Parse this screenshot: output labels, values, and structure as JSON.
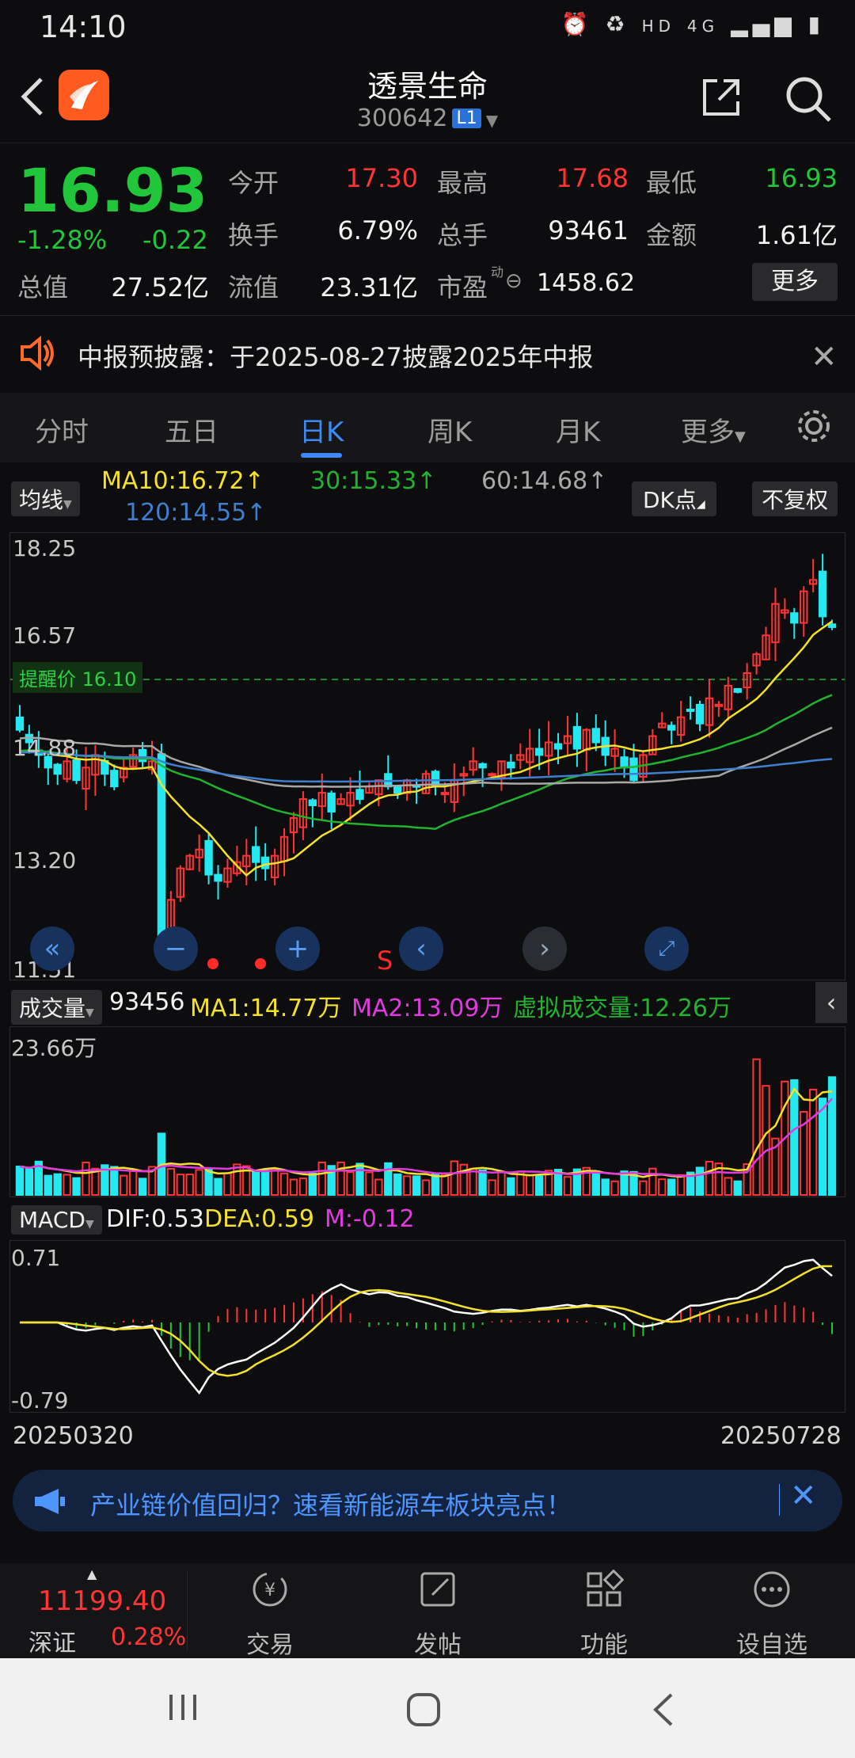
{
  "status_bar": {
    "time": "14:10",
    "hd": "HD",
    "network": "4G"
  },
  "header": {
    "title": "透景生命",
    "code": "300642",
    "level_badge": "L1"
  },
  "quote": {
    "price": "16.93",
    "change_pct": "-1.28%",
    "change": "-0.22",
    "open_label": "今开",
    "open": "17.30",
    "high_label": "最高",
    "high": "17.68",
    "low_label": "最低",
    "low": "16.93",
    "turnover_label": "换手",
    "turnover": "6.79%",
    "volume_label": "总手",
    "volume": "93461",
    "amount_label": "金额",
    "amount": "1.61亿",
    "mktcap_label": "总值",
    "mktcap": "27.52亿",
    "float_label": "流值",
    "float_cap": "23.31亿",
    "pe_label": "市盈",
    "pe_sup": "动",
    "pe": "1458.62",
    "more_label": "更多"
  },
  "notice": {
    "text": "中报预披露：于2025-08-27披露2025年中报"
  },
  "tabs": [
    {
      "label": "分时"
    },
    {
      "label": "五日"
    },
    {
      "label": "日K"
    },
    {
      "label": "周K"
    },
    {
      "label": "月K"
    },
    {
      "label": "更多"
    }
  ],
  "ma_row": {
    "indicator": "均线",
    "ma10": "MA10:16.72↑",
    "ma30": "30:15.33↑",
    "ma60": "60:14.68↑",
    "ma120": "120:14.55↑",
    "dk_label": "DK点",
    "adjust_label": "不复权"
  },
  "price_axis": {
    "top": "18.25",
    "mid1": "16.57",
    "mid2": "14.88",
    "low": "13.20",
    "bottom": "11.51"
  },
  "alert": {
    "label": "提醒价 16.10",
    "value": 16.1
  },
  "chart_controls": {
    "s_marker": "S"
  },
  "volume_row": {
    "indicator": "成交量",
    "volume": "93456",
    "ma1": "MA1:14.77万",
    "ma2": "MA2:13.09万",
    "virtual": "虚拟成交量:12.26万",
    "axis_top": "23.66万"
  },
  "macd_row": {
    "indicator": "MACD",
    "dif": "DIF:0.53",
    "dea": "DEA:0.59",
    "m": "M:-0.12",
    "axis_top": "0.71",
    "axis_bottom": "-0.79"
  },
  "date_range": {
    "start": "20250320",
    "end": "20250728"
  },
  "banner": {
    "text": "产业链价值回归？速看新能源车板块亮点！"
  },
  "bottom_nav": {
    "index_value": "11199.40",
    "index_name": "深证",
    "index_pct": "0.28%",
    "items": [
      {
        "label": "交易"
      },
      {
        "label": "发帖"
      },
      {
        "label": "功能"
      },
      {
        "label": "设自选"
      }
    ]
  },
  "colors": {
    "up": "#ff3535",
    "down": "#21c63a",
    "candle_down": "#25e8f0",
    "accent": "#3d8af7",
    "ma10": "#f5e12a",
    "ma30": "#21b32e",
    "ma60": "#a8a8a8",
    "ma120": "#3f7fd0",
    "macd_m": "#e23ae0"
  },
  "chart_data": {
    "type": "candlestick",
    "x_start": "20250320",
    "x_end": "20250728",
    "ylim": [
      11.51,
      18.25
    ],
    "closes": [
      15.3,
      15.1,
      14.9,
      14.7,
      14.6,
      14.8,
      14.5,
      14.7,
      14.9,
      14.6,
      14.4,
      14.7,
      14.9,
      14.8,
      14.8,
      12.0,
      12.6,
      13.1,
      13.3,
      13.4,
      13.0,
      12.9,
      13.1,
      13.2,
      13.3,
      13.2,
      13.1,
      13.3,
      13.6,
      13.9,
      14.2,
      14.1,
      14.3,
      14.0,
      14.2,
      14.3,
      14.2,
      14.4,
      14.5,
      14.4,
      14.3,
      14.5,
      14.4,
      14.6,
      14.4,
      14.3,
      14.5,
      14.6,
      14.8,
      14.7,
      14.6,
      14.8,
      14.7,
      14.9,
      15.0,
      14.9,
      15.1,
      15.0,
      15.2,
      15.0,
      15.3,
      15.1,
      14.9,
      15.0,
      14.7,
      14.5,
      14.9,
      15.2,
      15.4,
      15.3,
      15.5,
      15.6,
      15.4,
      15.8,
      15.7,
      16.0,
      15.9,
      16.2,
      16.5,
      16.8,
      17.3,
      17.2,
      17.0,
      17.5,
      17.68,
      17.1,
      16.93
    ],
    "volume_axis_top": "23.66万"
  }
}
